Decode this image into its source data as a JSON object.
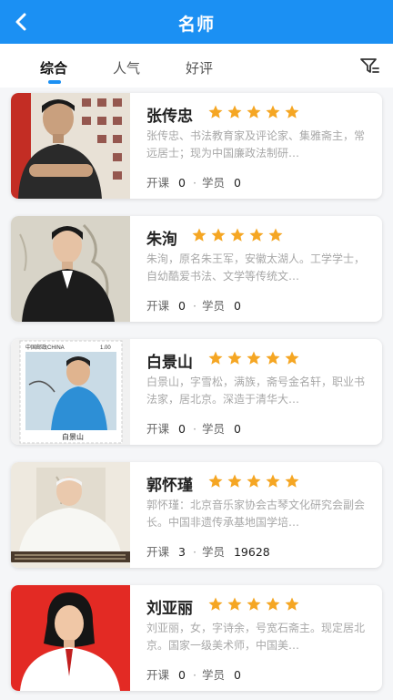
{
  "header": {
    "title": "名师",
    "back_icon": "chevron-left-icon",
    "color": "#1b90f3"
  },
  "tabs": [
    {
      "label": "综合",
      "active": true
    },
    {
      "label": "人气",
      "active": false
    },
    {
      "label": "好评",
      "active": false
    }
  ],
  "filter_icon": "filter-icon",
  "teachers": [
    {
      "name": "张传忠",
      "rating": 5,
      "description": "张传忠、书法教育家及评论家、集雅斋主，常远居士；现为中国廉政法制研…",
      "course_label": "开课",
      "courses": "0",
      "student_label": "学员",
      "students": "0"
    },
    {
      "name": "朱洵",
      "rating": 5,
      "description": "朱洵，原名朱王军，安徽太湖人。工学学士，自幼酷爱书法、文学等传统文…",
      "course_label": "开课",
      "courses": "0",
      "student_label": "学员",
      "students": "0"
    },
    {
      "name": "白景山",
      "rating": 5,
      "description": "白景山，字雪松，满族，斋号金名轩，职业书法家，居北京。深造于清华大…",
      "course_label": "开课",
      "courses": "0",
      "student_label": "学员",
      "students": "0",
      "stamp_country": "中国邮政CHINA",
      "stamp_value": "1.00",
      "stamp_name": "白景山"
    },
    {
      "name": "郭怀瑾",
      "rating": 5,
      "description": "郭怀瑾：北京音乐家协会古琴文化研究会副会长。中国非遗传承基地国学培…",
      "course_label": "开课",
      "courses": "3",
      "student_label": "学员",
      "students": "19628"
    },
    {
      "name": "刘亚丽",
      "rating": 5,
      "description": "刘亚丽，女，字诗余，号宽石斋主。现定居北京。国家一级美术师，中国美…",
      "course_label": "开课",
      "courses": "0",
      "student_label": "学员",
      "students": "0"
    }
  ],
  "colors": {
    "star": "#f5a623",
    "accent": "#1b90f3"
  }
}
